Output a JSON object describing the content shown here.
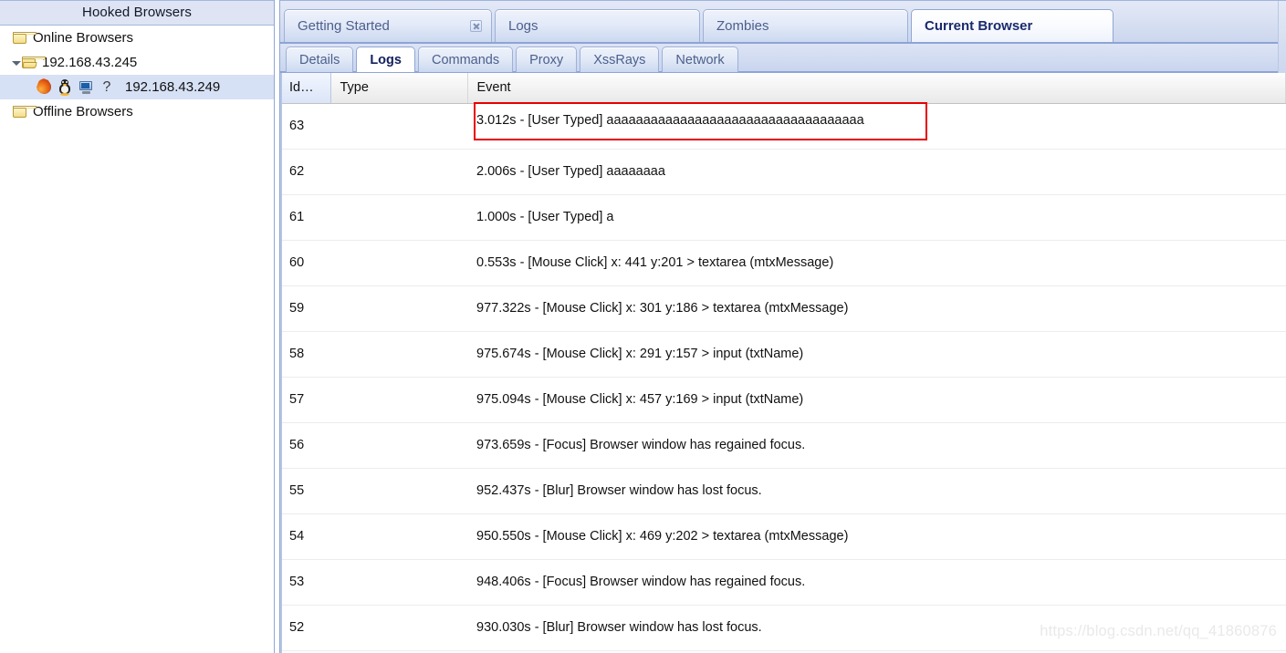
{
  "sidebar": {
    "header": "Hooked Browsers",
    "tree": [
      {
        "label": "Online Browsers",
        "icon": "folder-closed-icon",
        "level": 1,
        "twisty": "none",
        "selected": false
      },
      {
        "label": "192.168.43.245",
        "icon": "folder-open-icon",
        "level": 2,
        "twisty": "open",
        "selected": false
      },
      {
        "label": "192.168.43.249",
        "icon": "browser-host-icons",
        "level": 3,
        "twisty": "none",
        "selected": true,
        "host_icons": [
          "firefox-icon",
          "linux-tux-icon",
          "monitor-icon",
          "question-mark-icon"
        ]
      },
      {
        "label": "Offline Browsers",
        "icon": "folder-closed-icon",
        "level": 1,
        "twisty": "none",
        "selected": false
      }
    ]
  },
  "main": {
    "top_tabs": [
      {
        "label": "Getting Started",
        "active": false,
        "closable": true
      },
      {
        "label": "Logs",
        "active": false,
        "closable": false
      },
      {
        "label": "Zombies",
        "active": false,
        "closable": false
      },
      {
        "label": "Current Browser",
        "active": true,
        "closable": false
      }
    ],
    "sub_tabs": [
      {
        "label": "Details",
        "active": false
      },
      {
        "label": "Logs",
        "active": true
      },
      {
        "label": "Commands",
        "active": false
      },
      {
        "label": "Proxy",
        "active": false
      },
      {
        "label": "XssRays",
        "active": false
      },
      {
        "label": "Network",
        "active": false
      }
    ],
    "table": {
      "columns": [
        "Id…",
        "Type",
        "Event"
      ],
      "sorted_column": "Id…",
      "rows": [
        {
          "id": "63",
          "type": "",
          "event": "3.012s - [User Typed] aaaaaaaaaaaaaaaaaaaaaaaaaaaaaaaaaaa",
          "highlight": true
        },
        {
          "id": "62",
          "type": "",
          "event": "2.006s - [User Typed] aaaaaaaa",
          "highlight": false
        },
        {
          "id": "61",
          "type": "",
          "event": "1.000s - [User Typed] a",
          "highlight": false
        },
        {
          "id": "60",
          "type": "",
          "event": "0.553s - [Mouse Click] x: 441 y:201 > textarea (mtxMessage)",
          "highlight": false
        },
        {
          "id": "59",
          "type": "",
          "event": "977.322s - [Mouse Click] x: 301 y:186 > textarea (mtxMessage)",
          "highlight": false
        },
        {
          "id": "58",
          "type": "",
          "event": "975.674s - [Mouse Click] x: 291 y:157 > input (txtName)",
          "highlight": false
        },
        {
          "id": "57",
          "type": "",
          "event": "975.094s - [Mouse Click] x: 457 y:169 > input (txtName)",
          "highlight": false
        },
        {
          "id": "56",
          "type": "",
          "event": "973.659s - [Focus] Browser window has regained focus.",
          "highlight": false
        },
        {
          "id": "55",
          "type": "",
          "event": "952.437s - [Blur] Browser window has lost focus.",
          "highlight": false
        },
        {
          "id": "54",
          "type": "",
          "event": "950.550s - [Mouse Click] x: 469 y:202 > textarea (mtxMessage)",
          "highlight": false
        },
        {
          "id": "53",
          "type": "",
          "event": "948.406s - [Focus] Browser window has regained focus.",
          "highlight": false
        },
        {
          "id": "52",
          "type": "",
          "event": "930.030s - [Blur] Browser window has lost focus.",
          "highlight": false
        }
      ]
    }
  },
  "watermark": "https://blog.csdn.net/qq_41860876",
  "colors": {
    "chrome_blue": "#dee4f4",
    "tab_border": "#9db0d8",
    "active_tab_text": "#1a2a6c",
    "inactive_tab_text": "#4c5f8c",
    "selection": "#d7e1f5",
    "highlight_red": "#e60000",
    "watermark_grey": "#e9e9e9"
  }
}
